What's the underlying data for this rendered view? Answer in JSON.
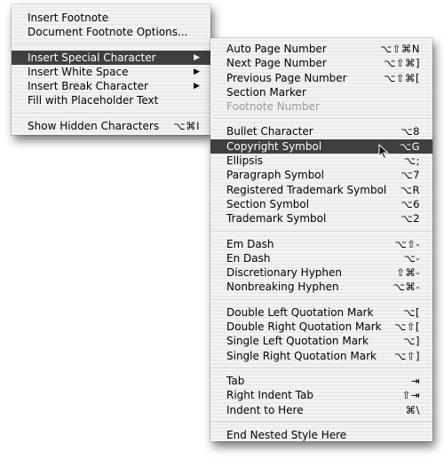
{
  "main_menu": {
    "items": [
      {
        "label": "Insert Footnote",
        "shortcut": ""
      },
      {
        "label": "Document Footnote Options...",
        "shortcut": ""
      },
      {
        "label": "Insert Special Character",
        "submenu_arrow": "▶",
        "selected": true
      },
      {
        "label": "Insert White Space",
        "submenu_arrow": "▶"
      },
      {
        "label": "Insert Break Character",
        "submenu_arrow": "▶"
      },
      {
        "label": "Fill with Placeholder Text",
        "shortcut": ""
      },
      {
        "label": "Show Hidden Characters",
        "shortcut": "⌥⌘I"
      }
    ]
  },
  "sub_menu": {
    "title": "Insert Special Character",
    "items": [
      {
        "label": "Auto Page Number",
        "shortcut": "⌥⇧⌘N"
      },
      {
        "label": "Next Page Number",
        "shortcut": "⌥⇧⌘]"
      },
      {
        "label": "Previous Page Number",
        "shortcut": "⌥⇧⌘["
      },
      {
        "label": "Section Marker",
        "shortcut": ""
      },
      {
        "label": "Footnote Number",
        "shortcut": "",
        "disabled": true
      },
      {
        "label": "Bullet Character",
        "shortcut": "⌥8"
      },
      {
        "label": "Copyright Symbol",
        "shortcut": "⌥G",
        "selected": true
      },
      {
        "label": "Ellipsis",
        "shortcut": "⌥;"
      },
      {
        "label": "Paragraph Symbol",
        "shortcut": "⌥7"
      },
      {
        "label": "Registered Trademark Symbol",
        "shortcut": "⌥R"
      },
      {
        "label": "Section Symbol",
        "shortcut": "⌥6"
      },
      {
        "label": "Trademark Symbol",
        "shortcut": "⌥2"
      },
      {
        "label": "Em Dash",
        "shortcut": "⌥⇧-"
      },
      {
        "label": "En Dash",
        "shortcut": "⌥-"
      },
      {
        "label": "Discretionary Hyphen",
        "shortcut": "⇧⌘-"
      },
      {
        "label": "Nonbreaking Hyphen",
        "shortcut": "⌥⌘-"
      },
      {
        "label": "Double Left Quotation Mark",
        "shortcut": "⌥["
      },
      {
        "label": "Double Right Quotation Mark",
        "shortcut": "⌥⇧["
      },
      {
        "label": "Single Left Quotation Mark",
        "shortcut": "⌥]"
      },
      {
        "label": "Single Right Quotation Mark",
        "shortcut": "⌥⇧]"
      },
      {
        "label": "Tab",
        "shortcut": "⇥"
      },
      {
        "label": "Right Indent Tab",
        "shortcut": "⇧⇥"
      },
      {
        "label": "Indent to Here",
        "shortcut": "⌘\\"
      },
      {
        "label": "End Nested Style Here",
        "shortcut": ""
      }
    ]
  },
  "colors": {
    "highlight": "#3f3f3f",
    "menu_background": "#f2f2f2",
    "disabled_text": "#9a9a9a"
  }
}
